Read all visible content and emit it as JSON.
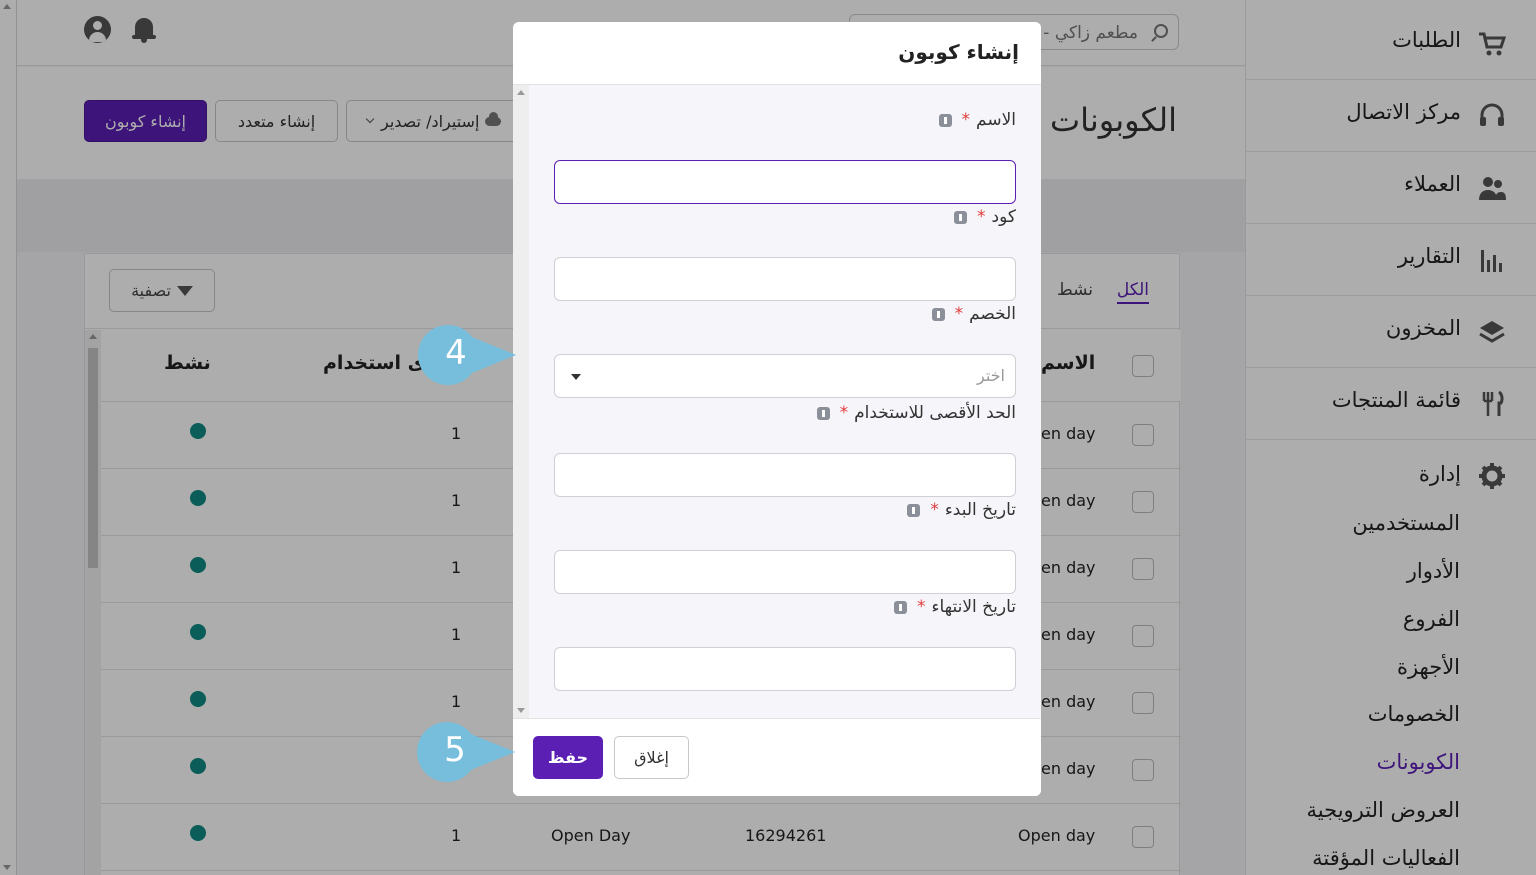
{
  "topbar": {
    "search_text": "مطعم زاكي -"
  },
  "header": {
    "page_title": "الكوبونات",
    "create_coupon_label": "إنشاء كوبون",
    "bulk_create_label": "إنشاء متعدد",
    "import_export_label": "إستيراد/ تصدير"
  },
  "table": {
    "tab_all": "الكل",
    "tab_active": "نشط",
    "filter_label": "تصفية",
    "headers": {
      "name": "الاسم",
      "max_usage": "ى استخدام",
      "active": "نشط"
    },
    "rows": [
      {
        "name": "en day",
        "max": "1"
      },
      {
        "name": "en day",
        "max": "1"
      },
      {
        "name": "en day",
        "max": "1"
      },
      {
        "name": "en day",
        "max": "1"
      },
      {
        "name": "en day",
        "max": "1"
      },
      {
        "name": "en day",
        "max": "1"
      },
      {
        "name": "Open day",
        "code": "16294261",
        "discount": "Open Day",
        "max": "1"
      }
    ]
  },
  "sidebar": {
    "items": [
      {
        "label": "الطلبات",
        "icon": "cart-icon"
      },
      {
        "label": "مركز الاتصال",
        "icon": "headset-icon"
      },
      {
        "label": "العملاء",
        "icon": "users-icon"
      },
      {
        "label": "التقارير",
        "icon": "bar-chart-icon"
      },
      {
        "label": "المخزون",
        "icon": "layers-icon"
      },
      {
        "label": "قائمة المنتجات",
        "icon": "fork-knife-icon"
      }
    ],
    "admin": {
      "label": "إدارة",
      "icon": "gear-icon",
      "sub_items": [
        "المستخدمين",
        "الأدوار",
        "الفروع",
        "الأجهزة",
        "الخصومات",
        "الكوبونات",
        "العروض الترويجية",
        "الفعاليات المؤقتة"
      ],
      "active_index": 5
    }
  },
  "modal": {
    "title": "إنشاء كوبون",
    "fields": [
      {
        "label": "الاسم",
        "value": ""
      },
      {
        "label": "كود",
        "value": ""
      },
      {
        "label": "الخصم",
        "placeholder": "اختر"
      },
      {
        "label": "الحد الأقصى للاستخدام",
        "value": ""
      },
      {
        "label": "تاريخ البدء",
        "value": ""
      },
      {
        "label": "تاريخ الانتهاء",
        "value": ""
      }
    ],
    "required_mark": "*",
    "save_label": "حفظ",
    "close_label": "إغلاق"
  },
  "callouts": [
    "4",
    "5"
  ],
  "colors": {
    "primary": "#5b1fb4",
    "active_dot": "#0f8a84",
    "required": "#e23b3b",
    "callout": "#76bedb"
  }
}
